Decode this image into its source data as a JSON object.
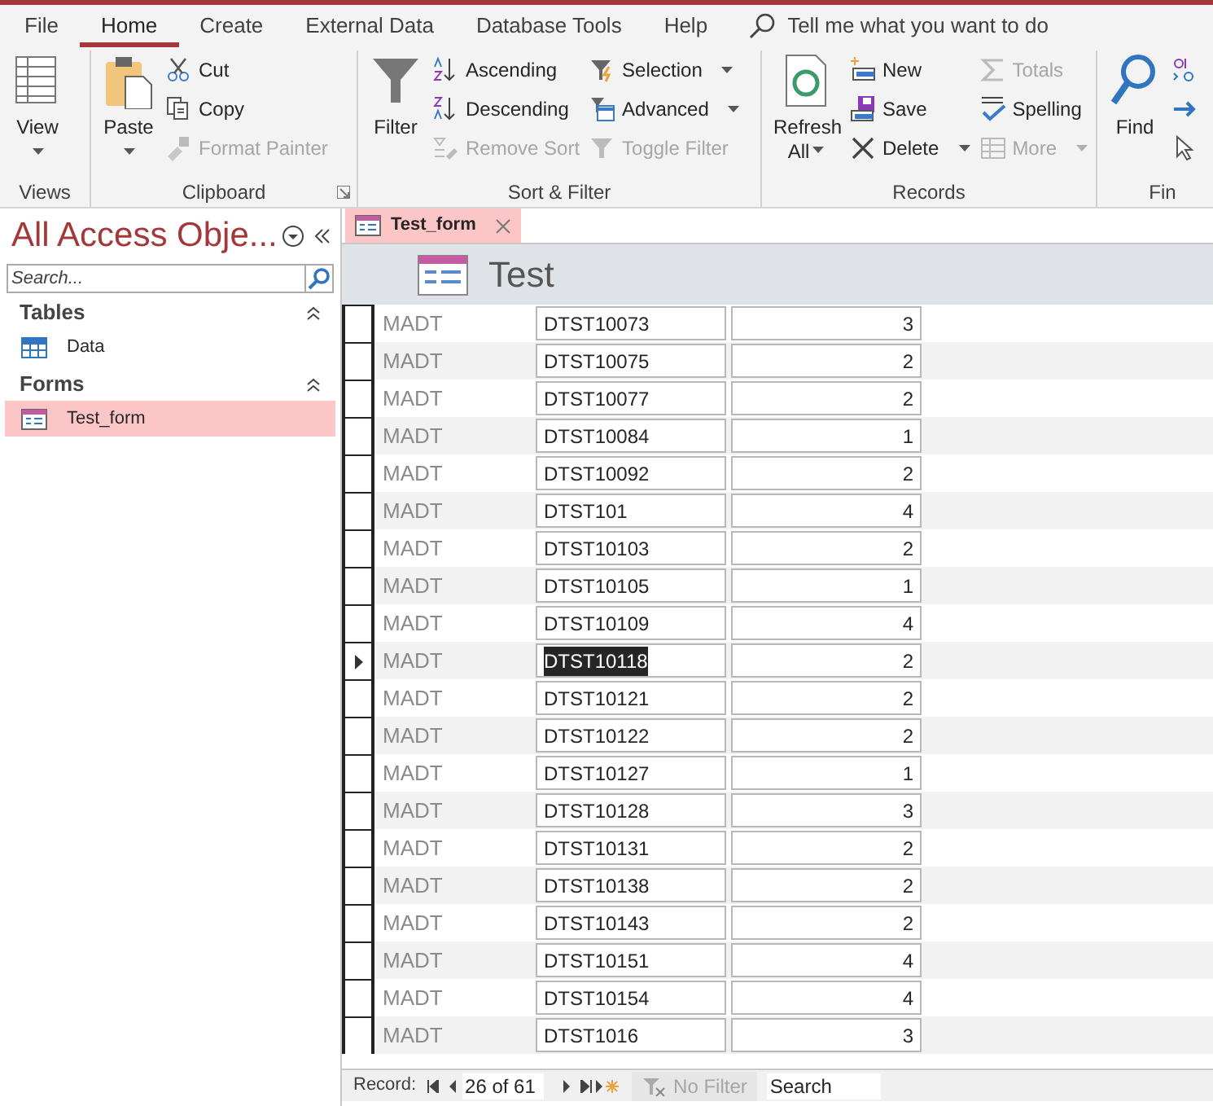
{
  "menu_tabs": [
    {
      "label": "File",
      "selected": false
    },
    {
      "label": "Home",
      "selected": true
    },
    {
      "label": "Create",
      "selected": false
    },
    {
      "label": "External Data",
      "selected": false
    },
    {
      "label": "Database Tools",
      "selected": false
    },
    {
      "label": "Help",
      "selected": false
    }
  ],
  "tell_me": {
    "placeholder": "Tell me what you want to do"
  },
  "ribbon_groups": [
    {
      "label": "Views",
      "items": [
        {
          "kind": "large",
          "label": "View",
          "dropdown": true,
          "disabled": false
        }
      ]
    },
    {
      "label": "Clipboard",
      "launcher": true,
      "items": [
        {
          "kind": "large",
          "label": "Paste",
          "dropdown": true,
          "disabled": false
        },
        {
          "kind": "small",
          "label": "Cut",
          "disabled": false
        },
        {
          "kind": "small",
          "label": "Copy",
          "disabled": false
        },
        {
          "kind": "small",
          "label": "Format Painter",
          "disabled": true
        }
      ]
    },
    {
      "label": "Sort & Filter",
      "items": [
        {
          "kind": "large",
          "label": "Filter",
          "disabled": false
        },
        {
          "kind": "small",
          "label": "Ascending",
          "disabled": false
        },
        {
          "kind": "small",
          "label": "Descending",
          "disabled": false
        },
        {
          "kind": "small",
          "label": "Remove Sort",
          "disabled": true
        },
        {
          "kind": "small",
          "label": "Selection",
          "dropdown": true,
          "disabled": false
        },
        {
          "kind": "small",
          "label": "Advanced",
          "dropdown": true,
          "disabled": false
        },
        {
          "kind": "small",
          "label": "Toggle Filter",
          "disabled": true
        }
      ]
    },
    {
      "label": "Records",
      "items": [
        {
          "kind": "large",
          "label": "Refresh All",
          "dropdown": true,
          "disabled": false
        },
        {
          "kind": "small",
          "label": "New",
          "disabled": false
        },
        {
          "kind": "small",
          "label": "Save",
          "disabled": false
        },
        {
          "kind": "small",
          "label": "Delete",
          "dropdown": true,
          "disabled": false
        },
        {
          "kind": "small",
          "label": "Totals",
          "disabled": true
        },
        {
          "kind": "small",
          "label": "Spelling",
          "disabled": false
        },
        {
          "kind": "small",
          "label": "More",
          "dropdown": true,
          "disabled": true
        }
      ]
    },
    {
      "label": "Fin",
      "items": [
        {
          "kind": "large",
          "label": "Find",
          "disabled": false
        },
        {
          "kind": "icon"
        },
        {
          "kind": "icon"
        },
        {
          "kind": "icon"
        }
      ]
    }
  ],
  "nav_pane": {
    "title": "All Access Obje...",
    "search": {
      "placeholder": "Search..."
    },
    "sections": [
      {
        "label": "Tables",
        "items": [
          {
            "label": "Data",
            "kind": "table",
            "selected": false
          }
        ]
      },
      {
        "label": "Forms",
        "items": [
          {
            "label": "Test_form",
            "kind": "form",
            "selected": true
          }
        ]
      }
    ]
  },
  "document_tab": {
    "label": "Test_form",
    "selected": true
  },
  "form": {
    "title": "Test",
    "rows": [
      {
        "label": "MADT",
        "code": "DTST10073",
        "count": "3",
        "current": false
      },
      {
        "label": "MADT",
        "code": "DTST10075",
        "count": "2",
        "current": false
      },
      {
        "label": "MADT",
        "code": "DTST10077",
        "count": "2",
        "current": false
      },
      {
        "label": "MADT",
        "code": "DTST10084",
        "count": "1",
        "current": false
      },
      {
        "label": "MADT",
        "code": "DTST10092",
        "count": "2",
        "current": false
      },
      {
        "label": "MADT",
        "code": "DTST101",
        "count": "4",
        "current": false
      },
      {
        "label": "MADT",
        "code": "DTST10103",
        "count": "2",
        "current": false
      },
      {
        "label": "MADT",
        "code": "DTST10105",
        "count": "1",
        "current": false
      },
      {
        "label": "MADT",
        "code": "DTST10109",
        "count": "4",
        "current": false
      },
      {
        "label": "MADT",
        "code": "DTST10118",
        "count": "2",
        "current": true
      },
      {
        "label": "MADT",
        "code": "DTST10121",
        "count": "2",
        "current": false
      },
      {
        "label": "MADT",
        "code": "DTST10122",
        "count": "2",
        "current": false
      },
      {
        "label": "MADT",
        "code": "DTST10127",
        "count": "1",
        "current": false
      },
      {
        "label": "MADT",
        "code": "DTST10128",
        "count": "3",
        "current": false
      },
      {
        "label": "MADT",
        "code": "DTST10131",
        "count": "2",
        "current": false
      },
      {
        "label": "MADT",
        "code": "DTST10138",
        "count": "2",
        "current": false
      },
      {
        "label": "MADT",
        "code": "DTST10143",
        "count": "2",
        "current": false
      },
      {
        "label": "MADT",
        "code": "DTST10151",
        "count": "4",
        "current": false
      },
      {
        "label": "MADT",
        "code": "DTST10154",
        "count": "4",
        "current": false
      },
      {
        "label": "MADT",
        "code": "DTST1016",
        "count": "3",
        "current": false
      }
    ]
  },
  "record_bar": {
    "label": "Record:",
    "position": "26 of 61",
    "filter": "No Filter",
    "filter_active": false,
    "search": {
      "placeholder": "Search"
    }
  }
}
